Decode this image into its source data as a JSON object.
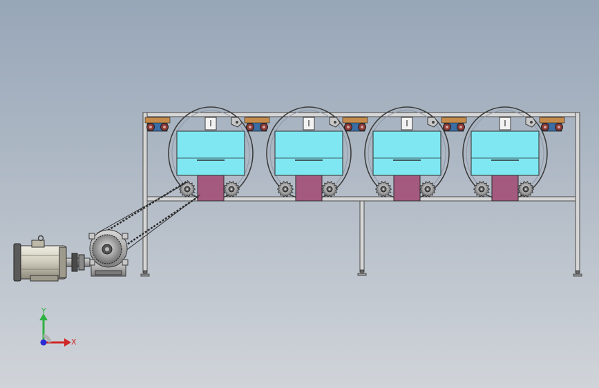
{
  "view": {
    "background_top": "#97a6b8",
    "background_bottom": "#d0d4d9"
  },
  "machine": {
    "drum_count": 4,
    "colors": {
      "frame": "#4a4a4a",
      "drum_ring": "#3c3c3c",
      "hopper": "#7fe7f2",
      "chute": "#a45a7e",
      "roller_red": "#8b3a36",
      "roller_blue": "#3a6ea5",
      "sprocket": "#a2a2a2",
      "motor_body": "#d8d4c6",
      "chain": "#2c2c2c"
    }
  },
  "triad": {
    "y_label": "Y",
    "x_label": "X",
    "y_color": "#2fb244",
    "x_color": "#d02727",
    "z_color": "#2a2ad6"
  }
}
